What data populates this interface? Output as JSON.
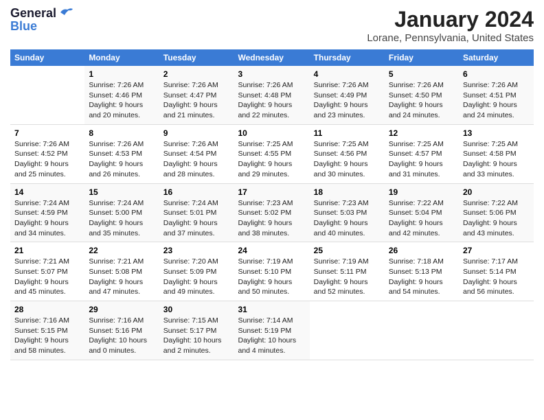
{
  "header": {
    "logo_line1": "General",
    "logo_line2": "Blue",
    "month_title": "January 2024",
    "location": "Lorane, Pennsylvania, United States"
  },
  "days_of_week": [
    "Sunday",
    "Monday",
    "Tuesday",
    "Wednesday",
    "Thursday",
    "Friday",
    "Saturday"
  ],
  "weeks": [
    [
      {
        "day": "",
        "sunrise": "",
        "sunset": "",
        "daylight": ""
      },
      {
        "day": "1",
        "sunrise": "Sunrise: 7:26 AM",
        "sunset": "Sunset: 4:46 PM",
        "daylight": "Daylight: 9 hours and 20 minutes."
      },
      {
        "day": "2",
        "sunrise": "Sunrise: 7:26 AM",
        "sunset": "Sunset: 4:47 PM",
        "daylight": "Daylight: 9 hours and 21 minutes."
      },
      {
        "day": "3",
        "sunrise": "Sunrise: 7:26 AM",
        "sunset": "Sunset: 4:48 PM",
        "daylight": "Daylight: 9 hours and 22 minutes."
      },
      {
        "day": "4",
        "sunrise": "Sunrise: 7:26 AM",
        "sunset": "Sunset: 4:49 PM",
        "daylight": "Daylight: 9 hours and 23 minutes."
      },
      {
        "day": "5",
        "sunrise": "Sunrise: 7:26 AM",
        "sunset": "Sunset: 4:50 PM",
        "daylight": "Daylight: 9 hours and 24 minutes."
      },
      {
        "day": "6",
        "sunrise": "Sunrise: 7:26 AM",
        "sunset": "Sunset: 4:51 PM",
        "daylight": "Daylight: 9 hours and 24 minutes."
      }
    ],
    [
      {
        "day": "7",
        "sunrise": "Sunrise: 7:26 AM",
        "sunset": "Sunset: 4:52 PM",
        "daylight": "Daylight: 9 hours and 25 minutes."
      },
      {
        "day": "8",
        "sunrise": "Sunrise: 7:26 AM",
        "sunset": "Sunset: 4:53 PM",
        "daylight": "Daylight: 9 hours and 26 minutes."
      },
      {
        "day": "9",
        "sunrise": "Sunrise: 7:26 AM",
        "sunset": "Sunset: 4:54 PM",
        "daylight": "Daylight: 9 hours and 28 minutes."
      },
      {
        "day": "10",
        "sunrise": "Sunrise: 7:25 AM",
        "sunset": "Sunset: 4:55 PM",
        "daylight": "Daylight: 9 hours and 29 minutes."
      },
      {
        "day": "11",
        "sunrise": "Sunrise: 7:25 AM",
        "sunset": "Sunset: 4:56 PM",
        "daylight": "Daylight: 9 hours and 30 minutes."
      },
      {
        "day": "12",
        "sunrise": "Sunrise: 7:25 AM",
        "sunset": "Sunset: 4:57 PM",
        "daylight": "Daylight: 9 hours and 31 minutes."
      },
      {
        "day": "13",
        "sunrise": "Sunrise: 7:25 AM",
        "sunset": "Sunset: 4:58 PM",
        "daylight": "Daylight: 9 hours and 33 minutes."
      }
    ],
    [
      {
        "day": "14",
        "sunrise": "Sunrise: 7:24 AM",
        "sunset": "Sunset: 4:59 PM",
        "daylight": "Daylight: 9 hours and 34 minutes."
      },
      {
        "day": "15",
        "sunrise": "Sunrise: 7:24 AM",
        "sunset": "Sunset: 5:00 PM",
        "daylight": "Daylight: 9 hours and 35 minutes."
      },
      {
        "day": "16",
        "sunrise": "Sunrise: 7:24 AM",
        "sunset": "Sunset: 5:01 PM",
        "daylight": "Daylight: 9 hours and 37 minutes."
      },
      {
        "day": "17",
        "sunrise": "Sunrise: 7:23 AM",
        "sunset": "Sunset: 5:02 PM",
        "daylight": "Daylight: 9 hours and 38 minutes."
      },
      {
        "day": "18",
        "sunrise": "Sunrise: 7:23 AM",
        "sunset": "Sunset: 5:03 PM",
        "daylight": "Daylight: 9 hours and 40 minutes."
      },
      {
        "day": "19",
        "sunrise": "Sunrise: 7:22 AM",
        "sunset": "Sunset: 5:04 PM",
        "daylight": "Daylight: 9 hours and 42 minutes."
      },
      {
        "day": "20",
        "sunrise": "Sunrise: 7:22 AM",
        "sunset": "Sunset: 5:06 PM",
        "daylight": "Daylight: 9 hours and 43 minutes."
      }
    ],
    [
      {
        "day": "21",
        "sunrise": "Sunrise: 7:21 AM",
        "sunset": "Sunset: 5:07 PM",
        "daylight": "Daylight: 9 hours and 45 minutes."
      },
      {
        "day": "22",
        "sunrise": "Sunrise: 7:21 AM",
        "sunset": "Sunset: 5:08 PM",
        "daylight": "Daylight: 9 hours and 47 minutes."
      },
      {
        "day": "23",
        "sunrise": "Sunrise: 7:20 AM",
        "sunset": "Sunset: 5:09 PM",
        "daylight": "Daylight: 9 hours and 49 minutes."
      },
      {
        "day": "24",
        "sunrise": "Sunrise: 7:19 AM",
        "sunset": "Sunset: 5:10 PM",
        "daylight": "Daylight: 9 hours and 50 minutes."
      },
      {
        "day": "25",
        "sunrise": "Sunrise: 7:19 AM",
        "sunset": "Sunset: 5:11 PM",
        "daylight": "Daylight: 9 hours and 52 minutes."
      },
      {
        "day": "26",
        "sunrise": "Sunrise: 7:18 AM",
        "sunset": "Sunset: 5:13 PM",
        "daylight": "Daylight: 9 hours and 54 minutes."
      },
      {
        "day": "27",
        "sunrise": "Sunrise: 7:17 AM",
        "sunset": "Sunset: 5:14 PM",
        "daylight": "Daylight: 9 hours and 56 minutes."
      }
    ],
    [
      {
        "day": "28",
        "sunrise": "Sunrise: 7:16 AM",
        "sunset": "Sunset: 5:15 PM",
        "daylight": "Daylight: 9 hours and 58 minutes."
      },
      {
        "day": "29",
        "sunrise": "Sunrise: 7:16 AM",
        "sunset": "Sunset: 5:16 PM",
        "daylight": "Daylight: 10 hours and 0 minutes."
      },
      {
        "day": "30",
        "sunrise": "Sunrise: 7:15 AM",
        "sunset": "Sunset: 5:17 PM",
        "daylight": "Daylight: 10 hours and 2 minutes."
      },
      {
        "day": "31",
        "sunrise": "Sunrise: 7:14 AM",
        "sunset": "Sunset: 5:19 PM",
        "daylight": "Daylight: 10 hours and 4 minutes."
      },
      {
        "day": "",
        "sunrise": "",
        "sunset": "",
        "daylight": ""
      },
      {
        "day": "",
        "sunrise": "",
        "sunset": "",
        "daylight": ""
      },
      {
        "day": "",
        "sunrise": "",
        "sunset": "",
        "daylight": ""
      }
    ]
  ]
}
